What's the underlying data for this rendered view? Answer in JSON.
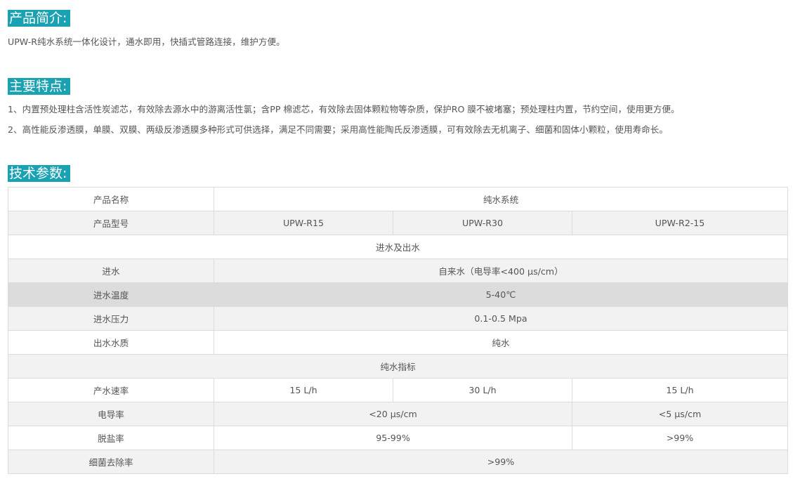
{
  "intro": {
    "heading": "产品简介:",
    "text": "UPW-R纯水系统一体化设计，通水即用，快插式管路连接，维护方便。"
  },
  "features": {
    "heading": "主要特点:",
    "items": [
      "1、内置预处理柱含活性炭滤芯，有效除去源水中的游离活性氯；含PP 棉滤芯，有效除去固体颗粒物等杂质，保护RO 膜不被堵塞；预处理柱内置，节约空间，使用更方便。",
      "2、高性能反渗透膜，单膜、双膜、两级反渗透膜多种形式可供选择，满足不同需要；采用高性能陶氏反渗透膜，可有效除去无机离子、细菌和固体小颗粒，使用寿命长。"
    ]
  },
  "specs": {
    "heading": "技术参数:",
    "product_name_label": "产品名称",
    "product_name_value": "纯水系统",
    "model_label": "产品型号",
    "models": [
      "UPW-R15",
      "UPW-R30",
      "UPW-R2-15"
    ],
    "section_inout": "进水及出水",
    "feed_water_label": "进水",
    "feed_water_value": "自来水（电导率<400 μs/cm）",
    "feed_temp_label": "进水温度",
    "feed_temp_value": "5-40℃",
    "feed_pressure_label": "进水压力",
    "feed_pressure_value": "0.1-0.5 Mpa",
    "output_quality_label": "出水水质",
    "output_quality_value": "纯水",
    "section_indicators": "纯水指标",
    "flow_rate_label": "产水速率",
    "flow_rates": [
      "15 L/h",
      "30 L/h",
      "15  L/h"
    ],
    "conductivity_label": "电导率",
    "conductivity_r15_r30": "<20 μs/cm",
    "conductivity_r2_15": "<5 μs/cm",
    "desalination_label": "脱盐率",
    "desalination_r15_r30": "95-99%",
    "desalination_r2_15": ">99%",
    "bacteria_label": "细菌去除率",
    "bacteria_value": ">99%"
  },
  "colors": {
    "heading_bg": "#1aa2b3",
    "heading_text": "#ffffff",
    "body_text": "#555555",
    "row_alt": "#f2f2f2",
    "row_highlight": "#dcdcdc",
    "border": "#dcdcdc"
  }
}
